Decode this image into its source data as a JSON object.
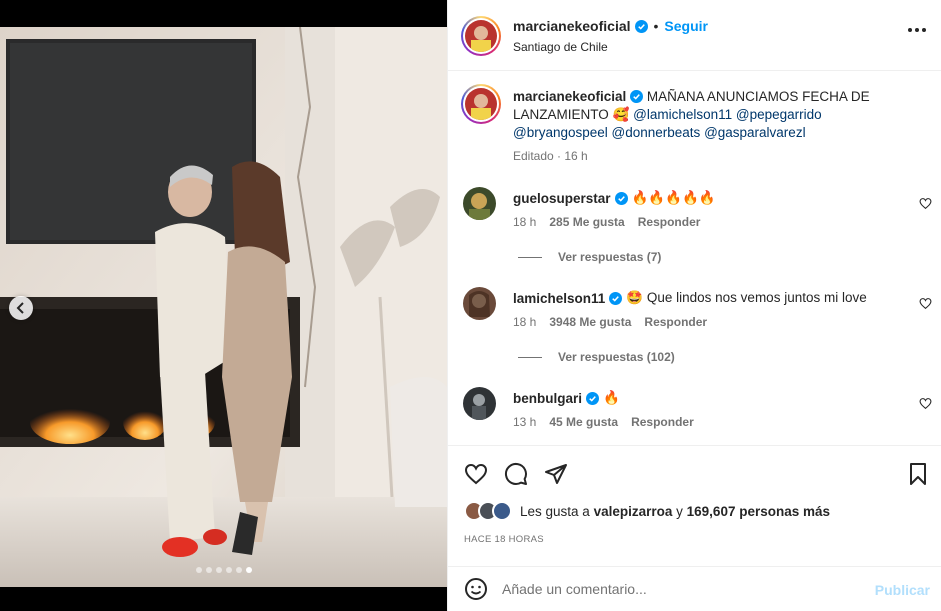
{
  "post": {
    "username": "marcianekeoficial",
    "follow_label": "Seguir",
    "location": "Santiago de Chile",
    "bullet": "•"
  },
  "caption": {
    "username": "marcianekeoficial",
    "text": "MAÑANA ANUNCIAMOS FECHA DE LANZAMIENTO",
    "emoji": "🥰",
    "mentions": [
      "@lamichelson11",
      "@pepegarrido",
      "@bryangospeel",
      "@donnerbeats",
      "@gasparalvarezl"
    ],
    "meta": "Editado · 16 h"
  },
  "comments": [
    {
      "username": "guelosuperstar",
      "text": "🔥🔥🔥🔥🔥",
      "time": "18 h",
      "likes": "285 Me gusta",
      "reply": "Responder",
      "replies_label": "Ver respuestas (7)"
    },
    {
      "username": "lamichelson11",
      "text": "🤩 Que lindos nos vemos juntos mi love",
      "time": "18 h",
      "likes": "3948 Me gusta",
      "reply": "Responder",
      "replies_label": "Ver respuestas (102)"
    },
    {
      "username": "benbulgari",
      "text": "🔥",
      "time": "13 h",
      "likes": "45 Me gusta",
      "reply": "Responder"
    }
  ],
  "likes": {
    "prefix": "Les gusta a",
    "user": "valepizarroa",
    "joiner": "y",
    "others": "169,607 personas más"
  },
  "time_ago": "HACE 18 HORAS",
  "comment_input": {
    "placeholder": "Añade un comentario...",
    "submit_label": "Publicar"
  },
  "carousel": {
    "total": 6,
    "active_index": 5
  },
  "colors": {
    "accent": "#0095f6",
    "mention": "#00376b",
    "muted": "#737373",
    "publish_disabled": "#b2dffc",
    "verified": "#0095f6"
  },
  "icons": [
    "more-icon",
    "verified-icon",
    "heart-icon",
    "comment-icon",
    "share-icon",
    "save-icon",
    "emoji-icon",
    "chevron-left-icon"
  ]
}
